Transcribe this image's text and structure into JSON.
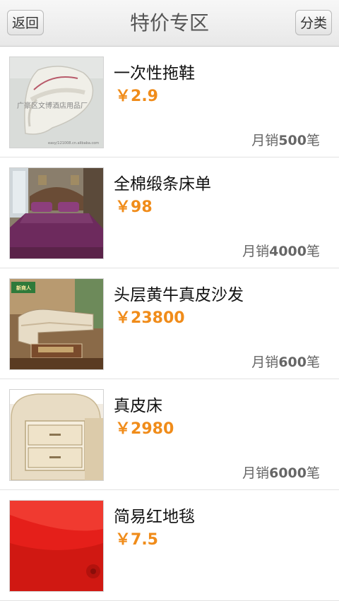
{
  "header": {
    "back_label": "返回",
    "title": "特价专区",
    "category_label": "分类"
  },
  "currency_symbol": "￥",
  "sales_prefix": "月销",
  "sales_suffix": "笔",
  "products": [
    {
      "name": "一次性拖鞋",
      "price": "2.9",
      "monthly_sales": "500",
      "image": "slippers-photo",
      "image_caption": "广豪区文博酒店用品厂",
      "image_footer": "easy/121008.cn.alibaba.com"
    },
    {
      "name": "全棉缎条床单",
      "price": "98",
      "monthly_sales": "4000",
      "image": "bedsheet-photo"
    },
    {
      "name": "头层黄牛真皮沙发",
      "price": "23800",
      "monthly_sales": "600",
      "image": "sofa-photo",
      "image_caption": "新商人"
    },
    {
      "name": "真皮床",
      "price": "2980",
      "monthly_sales": "6000",
      "image": "leather-bed-photo"
    },
    {
      "name": "简易红地毯",
      "price": "7.5",
      "image": "red-carpet-photo"
    }
  ]
}
